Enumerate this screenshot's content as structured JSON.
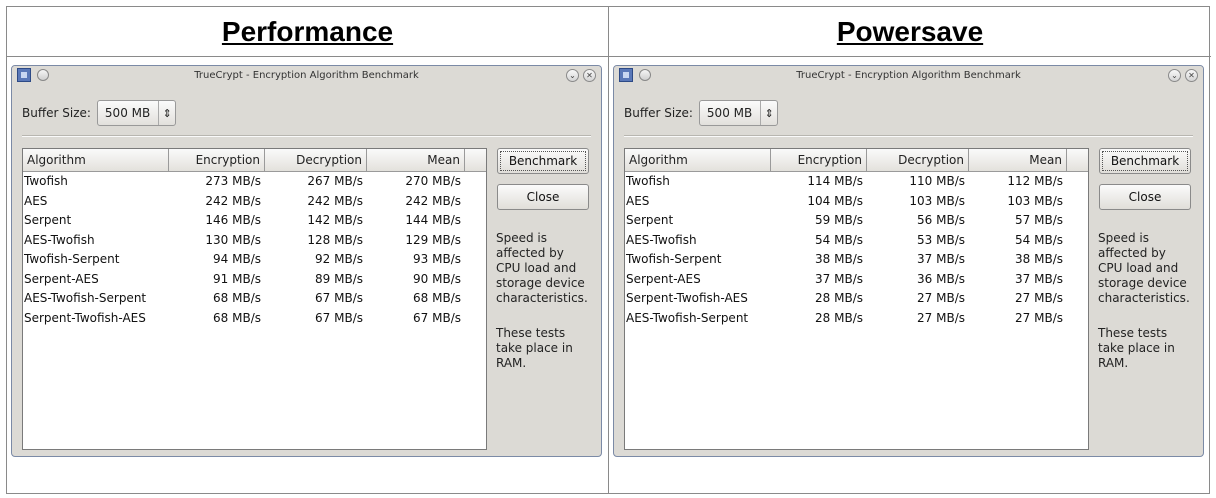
{
  "panels": [
    {
      "heading": "Performance",
      "window": {
        "title": "TrueCrypt - Encryption Algorithm Benchmark",
        "buffer_label": "Buffer Size:",
        "buffer_value": "500 MB",
        "columns": [
          "Algorithm",
          "Encryption",
          "Decryption",
          "Mean"
        ],
        "rows": [
          [
            "Twofish",
            "273 MB/s",
            "267 MB/s",
            "270 MB/s"
          ],
          [
            "AES",
            "242 MB/s",
            "242 MB/s",
            "242 MB/s"
          ],
          [
            "Serpent",
            "146 MB/s",
            "142 MB/s",
            "144 MB/s"
          ],
          [
            "AES-Twofish",
            "130 MB/s",
            "128 MB/s",
            "129 MB/s"
          ],
          [
            "Twofish-Serpent",
            "94 MB/s",
            "92 MB/s",
            "93 MB/s"
          ],
          [
            "Serpent-AES",
            "91 MB/s",
            "89 MB/s",
            "90 MB/s"
          ],
          [
            "AES-Twofish-Serpent",
            "68 MB/s",
            "67 MB/s",
            "68 MB/s"
          ],
          [
            "Serpent-Twofish-AES",
            "68 MB/s",
            "67 MB/s",
            "67 MB/s"
          ]
        ],
        "benchmark_label": "Benchmark",
        "close_label": "Close",
        "note1": "Speed is\naffected by\nCPU load and\nstorage device\ncharacteristics.",
        "note2": "These tests\ntake place in\nRAM."
      }
    },
    {
      "heading": "Powersave",
      "window": {
        "title": "TrueCrypt - Encryption Algorithm Benchmark",
        "buffer_label": "Buffer Size:",
        "buffer_value": "500 MB",
        "columns": [
          "Algorithm",
          "Encryption",
          "Decryption",
          "Mean"
        ],
        "rows": [
          [
            "Twofish",
            "114 MB/s",
            "110 MB/s",
            "112 MB/s"
          ],
          [
            "AES",
            "104 MB/s",
            "103 MB/s",
            "103 MB/s"
          ],
          [
            "Serpent",
            "59 MB/s",
            "56 MB/s",
            "57 MB/s"
          ],
          [
            "AES-Twofish",
            "54 MB/s",
            "53 MB/s",
            "54 MB/s"
          ],
          [
            "Twofish-Serpent",
            "38 MB/s",
            "37 MB/s",
            "38 MB/s"
          ],
          [
            "Serpent-AES",
            "37 MB/s",
            "36 MB/s",
            "37 MB/s"
          ],
          [
            "Serpent-Twofish-AES",
            "28 MB/s",
            "27 MB/s",
            "27 MB/s"
          ],
          [
            "AES-Twofish-Serpent",
            "28 MB/s",
            "27 MB/s",
            "27 MB/s"
          ]
        ],
        "benchmark_label": "Benchmark",
        "close_label": "Close",
        "note1": "Speed is\naffected by\nCPU load and\nstorage device\ncharacteristics.",
        "note2": "These tests\ntake place in\nRAM."
      }
    }
  ],
  "icons": {
    "app": "truecrypt-app-icon",
    "menu": "window-menu-circle-icon",
    "minimize": "minimize-chevron-icon",
    "close": "close-x-icon",
    "spinner": "spin-updown-icon"
  },
  "colors": {
    "window_bg": "#dcdad5",
    "list_bg": "#ffffff",
    "border": "#8a8a8a"
  }
}
